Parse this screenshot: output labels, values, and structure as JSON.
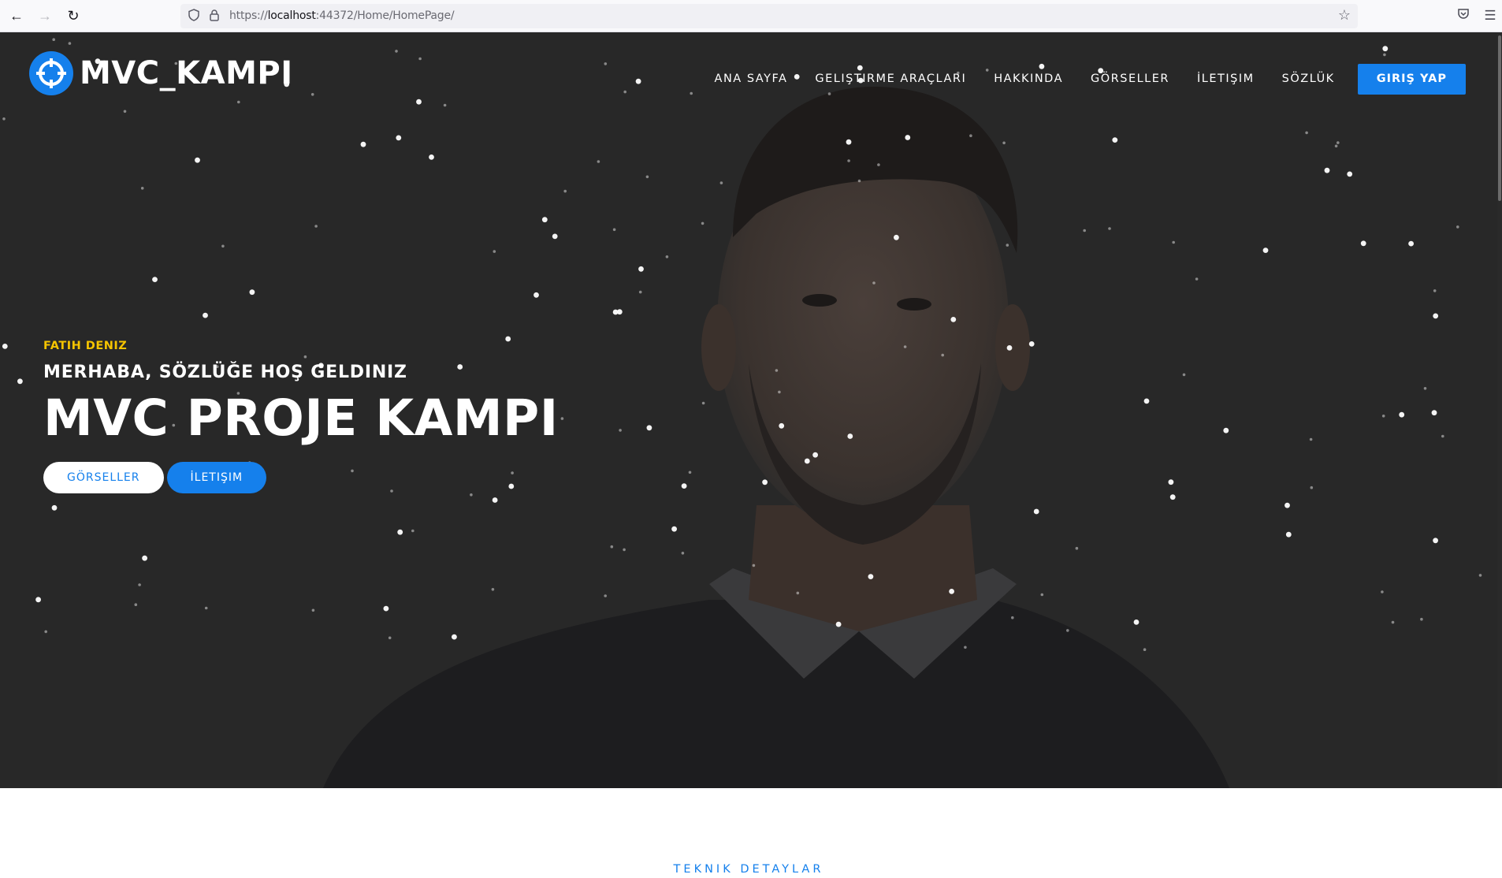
{
  "browser": {
    "url_prefix": "https://",
    "url_host": "localhost",
    "url_rest": ":44372/Home/HomePage/"
  },
  "site": {
    "logo_text": "MVC_KAMPI",
    "menu": [
      "ANA SAYFA",
      "GELIŞTIRME ARAÇLARI",
      "HAKKINDA",
      "GÖRSELLER",
      "İLETIŞIM",
      "SÖZLÜK"
    ],
    "login_label": "GIRIŞ YAP",
    "accent_color": "#1580ec",
    "kicker_color": "#f5c400"
  },
  "hero": {
    "kicker": "FATIH DENIZ",
    "subtitle": "MERHABA, SÖZLÜĞE HOŞ GELDINIZ",
    "headline": "MVC PROJE KAMPI",
    "btn_gallery": "GÖRSELLER",
    "btn_contact": "İLETIŞIM"
  },
  "section": {
    "title": "TEKNIK DETAYLAR"
  }
}
